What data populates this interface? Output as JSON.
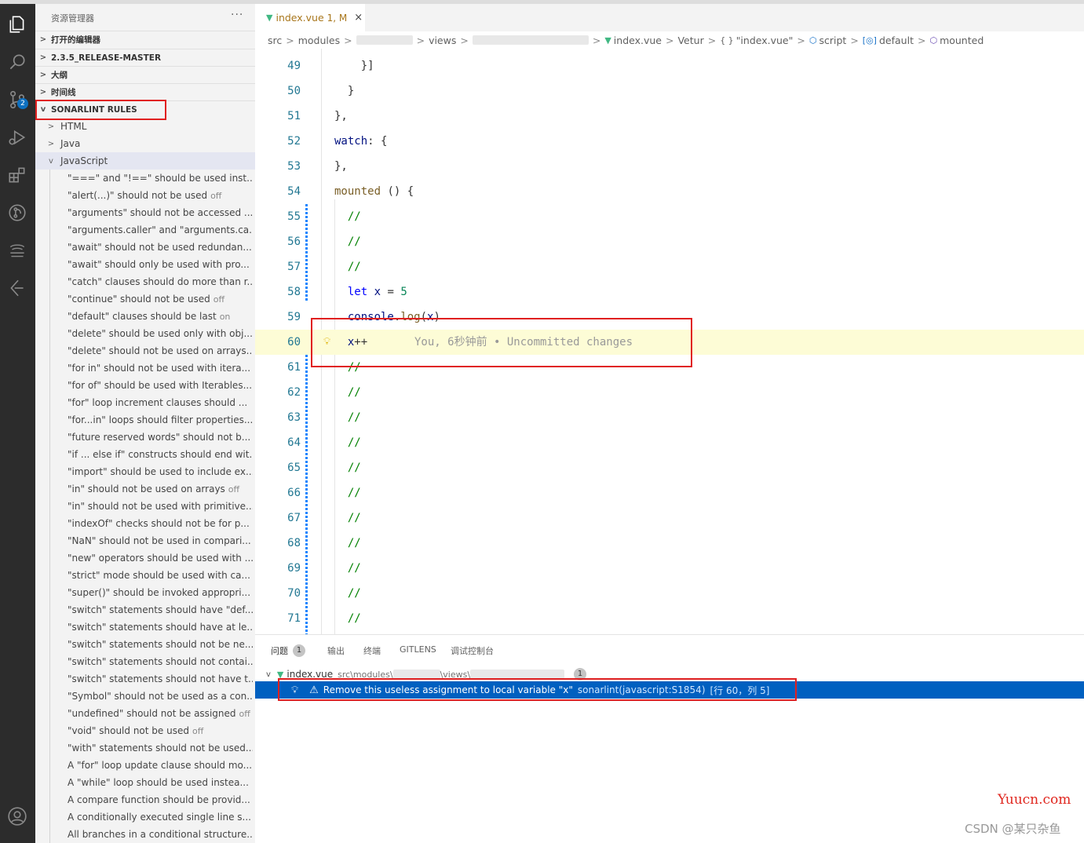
{
  "sidebar": {
    "title": "资源管理器",
    "more": "···",
    "sections": [
      {
        "label": "打开的编辑器",
        "expanded": false
      },
      {
        "label": "2.3.5_RELEASE-MASTER",
        "expanded": false
      },
      {
        "label": "大纲",
        "expanded": false
      },
      {
        "label": "时间线",
        "expanded": false
      },
      {
        "label": "SONARLINT RULES",
        "expanded": true
      }
    ],
    "languages": [
      {
        "label": "HTML",
        "expanded": false
      },
      {
        "label": "Java",
        "expanded": false
      },
      {
        "label": "JavaScript",
        "expanded": true
      }
    ],
    "rules": [
      {
        "text": "\"===\" and \"!==\" should be used inst...",
        "off": ""
      },
      {
        "text": "\"alert(...)\" should not be used",
        "off": "off"
      },
      {
        "text": "\"arguments\" should not be accessed ...",
        "off": ""
      },
      {
        "text": "\"arguments.caller\" and \"arguments.ca...",
        "off": ""
      },
      {
        "text": "\"await\" should not be used redundan...",
        "off": ""
      },
      {
        "text": "\"await\" should only be used with pro...",
        "off": ""
      },
      {
        "text": "\"catch\" clauses should do more than r...",
        "off": ""
      },
      {
        "text": "\"continue\" should not be used",
        "off": "off"
      },
      {
        "text": "\"default\" clauses should be last",
        "off": "on"
      },
      {
        "text": "\"delete\" should be used only with obj...",
        "off": ""
      },
      {
        "text": "\"delete\" should not be used on arrays...",
        "off": ""
      },
      {
        "text": "\"for in\" should not be used with itera...",
        "off": ""
      },
      {
        "text": "\"for of\" should be used with Iterables...",
        "off": ""
      },
      {
        "text": "\"for\" loop increment clauses should ...",
        "off": ""
      },
      {
        "text": "\"for...in\" loops should filter properties...",
        "off": ""
      },
      {
        "text": "\"future reserved words\" should not b...",
        "off": ""
      },
      {
        "text": "\"if ... else if\" constructs should end wit...",
        "off": ""
      },
      {
        "text": "\"import\" should be used to include ex...",
        "off": ""
      },
      {
        "text": "\"in\" should not be used on arrays",
        "off": "off"
      },
      {
        "text": "\"in\" should not be used with primitive...",
        "off": ""
      },
      {
        "text": "\"indexOf\" checks should not be for p...",
        "off": ""
      },
      {
        "text": "\"NaN\" should not be used in compari...",
        "off": ""
      },
      {
        "text": "\"new\" operators should be used with ...",
        "off": ""
      },
      {
        "text": "\"strict\" mode should be used with ca...",
        "off": ""
      },
      {
        "text": "\"super()\" should be invoked appropri...",
        "off": ""
      },
      {
        "text": "\"switch\" statements should have \"def...",
        "off": ""
      },
      {
        "text": "\"switch\" statements should have at le...",
        "off": ""
      },
      {
        "text": "\"switch\" statements should not be ne...",
        "off": ""
      },
      {
        "text": "\"switch\" statements should not contai...",
        "off": ""
      },
      {
        "text": "\"switch\" statements should not have t...",
        "off": ""
      },
      {
        "text": "\"Symbol\" should not be used as a con...",
        "off": ""
      },
      {
        "text": "\"undefined\" should not be assigned",
        "off": "off"
      },
      {
        "text": "\"void\" should not be used",
        "off": "off"
      },
      {
        "text": "\"with\" statements should not be used...",
        "off": ""
      },
      {
        "text": "A \"for\" loop update clause should mo...",
        "off": ""
      },
      {
        "text": "A \"while\" loop should be used instea...",
        "off": ""
      },
      {
        "text": "A compare function should be provid...",
        "off": ""
      },
      {
        "text": "A conditionally executed single line s...",
        "off": ""
      },
      {
        "text": "All branches in a conditional structure...",
        "off": ""
      }
    ]
  },
  "activity": {
    "badge": "2",
    "icons": [
      "explorer-icon",
      "search-icon",
      "source-control-icon",
      "run-debug-icon",
      "extensions-icon",
      "gitlens-icon",
      "jfrog-icon",
      "remote-icon",
      "account-icon"
    ]
  },
  "tab": {
    "label": "index.vue",
    "status": "1, M",
    "close": "×"
  },
  "breadcrumb": {
    "src": "src",
    "modules": "modules",
    "views": "views",
    "file": "index.vue",
    "vetur": "Vetur",
    "object": "\"index.vue\"",
    "object_icon": "{ }",
    "script": "script",
    "default": "default",
    "mounted": "mounted"
  },
  "editor": {
    "lines": [
      {
        "n": "49",
        "code": "    }]"
      },
      {
        "n": "50",
        "code": "  }"
      },
      {
        "n": "51",
        "code": "},"
      },
      {
        "n": "52",
        "code": "watch: {"
      },
      {
        "n": "53",
        "code": "},"
      },
      {
        "n": "54",
        "code": "mounted () {"
      },
      {
        "n": "55",
        "code": "  //"
      },
      {
        "n": "56",
        "code": "  //"
      },
      {
        "n": "57",
        "code": "  //"
      },
      {
        "n": "58",
        "code": "  let x = 5"
      },
      {
        "n": "59",
        "code": "  console.log(x)"
      },
      {
        "n": "60",
        "code": "  x++"
      },
      {
        "n": "61",
        "code": "  //"
      },
      {
        "n": "62",
        "code": "  //"
      },
      {
        "n": "63",
        "code": "  //"
      },
      {
        "n": "64",
        "code": "  //"
      },
      {
        "n": "65",
        "code": "  //"
      },
      {
        "n": "66",
        "code": "  //"
      },
      {
        "n": "67",
        "code": "  //"
      },
      {
        "n": "68",
        "code": "  //"
      },
      {
        "n": "69",
        "code": "  //"
      },
      {
        "n": "70",
        "code": "  //"
      },
      {
        "n": "71",
        "code": "  //"
      }
    ],
    "blame": "You, 6秒钟前 • Uncommitted changes"
  },
  "panel": {
    "tabs": [
      {
        "label": "问题",
        "count": "1"
      },
      {
        "label": "输出",
        "count": ""
      },
      {
        "label": "终端",
        "count": ""
      },
      {
        "label": "GITLENS",
        "count": ""
      },
      {
        "label": "调试控制台",
        "count": ""
      }
    ],
    "file": "index.vue",
    "file_path_a": "src\\modules\\",
    "file_path_b": "\\views\\",
    "file_count": "1",
    "issue_message": "Remove this useless assignment to local variable \"x\"",
    "issue_source": "sonarlint(javascript:S1854)",
    "issue_location": "[行 60，列 5]"
  },
  "watermark": {
    "site": "Yuucn.com",
    "author": "CSDN @某只杂鱼"
  },
  "colors": {
    "accent": "#0060c0",
    "annotation": "#e02020",
    "highlight_line": "#fdfcd6",
    "vue": "#41b883"
  }
}
